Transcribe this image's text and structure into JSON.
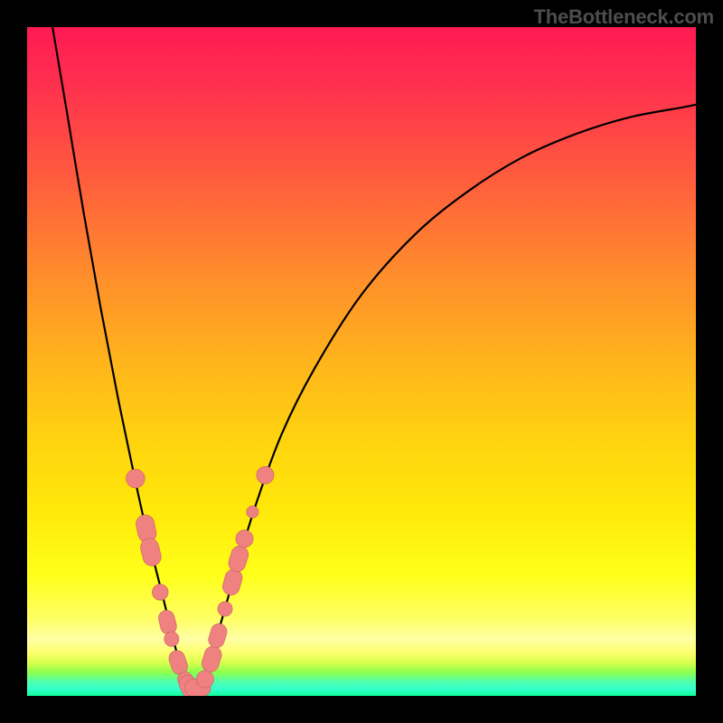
{
  "watermark": "TheBottleneck.com",
  "colors": {
    "frame": "#000000",
    "curve": "#000000",
    "bead_fill": "#ef8181",
    "bead_stroke": "#c96060"
  },
  "chart_data": {
    "type": "line",
    "title": "",
    "xlabel": "",
    "ylabel": "",
    "xlim": [
      0,
      1
    ],
    "ylim": [
      0,
      1
    ],
    "note": "Axes unlabeled; values are normalized positions read from pixels. V-shaped curve with minimum near x≈0.25 reaching y≈0 (bottom). Background gradient encodes height: red≈high, green≈low.",
    "series": [
      {
        "name": "curve",
        "x": [
          0.038,
          0.06,
          0.085,
          0.11,
          0.135,
          0.16,
          0.18,
          0.2,
          0.215,
          0.225,
          0.235,
          0.245,
          0.255,
          0.265,
          0.275,
          0.29,
          0.31,
          0.34,
          0.38,
          0.43,
          0.5,
          0.58,
          0.66,
          0.74,
          0.82,
          0.9,
          0.98,
          1.0
        ],
        "y": [
          1.0,
          0.87,
          0.72,
          0.58,
          0.45,
          0.33,
          0.24,
          0.16,
          0.1,
          0.06,
          0.03,
          0.01,
          0.01,
          0.03,
          0.06,
          0.11,
          0.18,
          0.28,
          0.39,
          0.49,
          0.6,
          0.69,
          0.755,
          0.805,
          0.84,
          0.865,
          0.88,
          0.884
        ]
      }
    ],
    "beads": {
      "description": "Salmon-colored lozenge/circle markers clustered near the curve's trough on both arms.",
      "points": [
        {
          "x": 0.162,
          "y": 0.325,
          "r": 0.014,
          "shape": "circle"
        },
        {
          "x": 0.178,
          "y": 0.25,
          "r": 0.016,
          "shape": "lozenge"
        },
        {
          "x": 0.185,
          "y": 0.215,
          "r": 0.016,
          "shape": "lozenge"
        },
        {
          "x": 0.199,
          "y": 0.155,
          "r": 0.012,
          "shape": "circle"
        },
        {
          "x": 0.21,
          "y": 0.11,
          "r": 0.014,
          "shape": "lozenge"
        },
        {
          "x": 0.216,
          "y": 0.085,
          "r": 0.011,
          "shape": "circle"
        },
        {
          "x": 0.226,
          "y": 0.05,
          "r": 0.014,
          "shape": "lozenge"
        },
        {
          "x": 0.236,
          "y": 0.025,
          "r": 0.011,
          "shape": "circle"
        },
        {
          "x": 0.243,
          "y": 0.012,
          "r": 0.015,
          "shape": "lozenge"
        },
        {
          "x": 0.255,
          "y": 0.012,
          "r": 0.015,
          "shape": "lozenge"
        },
        {
          "x": 0.266,
          "y": 0.025,
          "r": 0.013,
          "shape": "circle"
        },
        {
          "x": 0.276,
          "y": 0.055,
          "r": 0.015,
          "shape": "lozenge"
        },
        {
          "x": 0.285,
          "y": 0.09,
          "r": 0.014,
          "shape": "lozenge"
        },
        {
          "x": 0.296,
          "y": 0.13,
          "r": 0.011,
          "shape": "circle"
        },
        {
          "x": 0.307,
          "y": 0.17,
          "r": 0.015,
          "shape": "lozenge"
        },
        {
          "x": 0.316,
          "y": 0.205,
          "r": 0.015,
          "shape": "lozenge"
        },
        {
          "x": 0.325,
          "y": 0.235,
          "r": 0.013,
          "shape": "circle"
        },
        {
          "x": 0.337,
          "y": 0.275,
          "r": 0.009,
          "shape": "circle"
        },
        {
          "x": 0.356,
          "y": 0.33,
          "r": 0.013,
          "shape": "circle"
        }
      ]
    }
  }
}
